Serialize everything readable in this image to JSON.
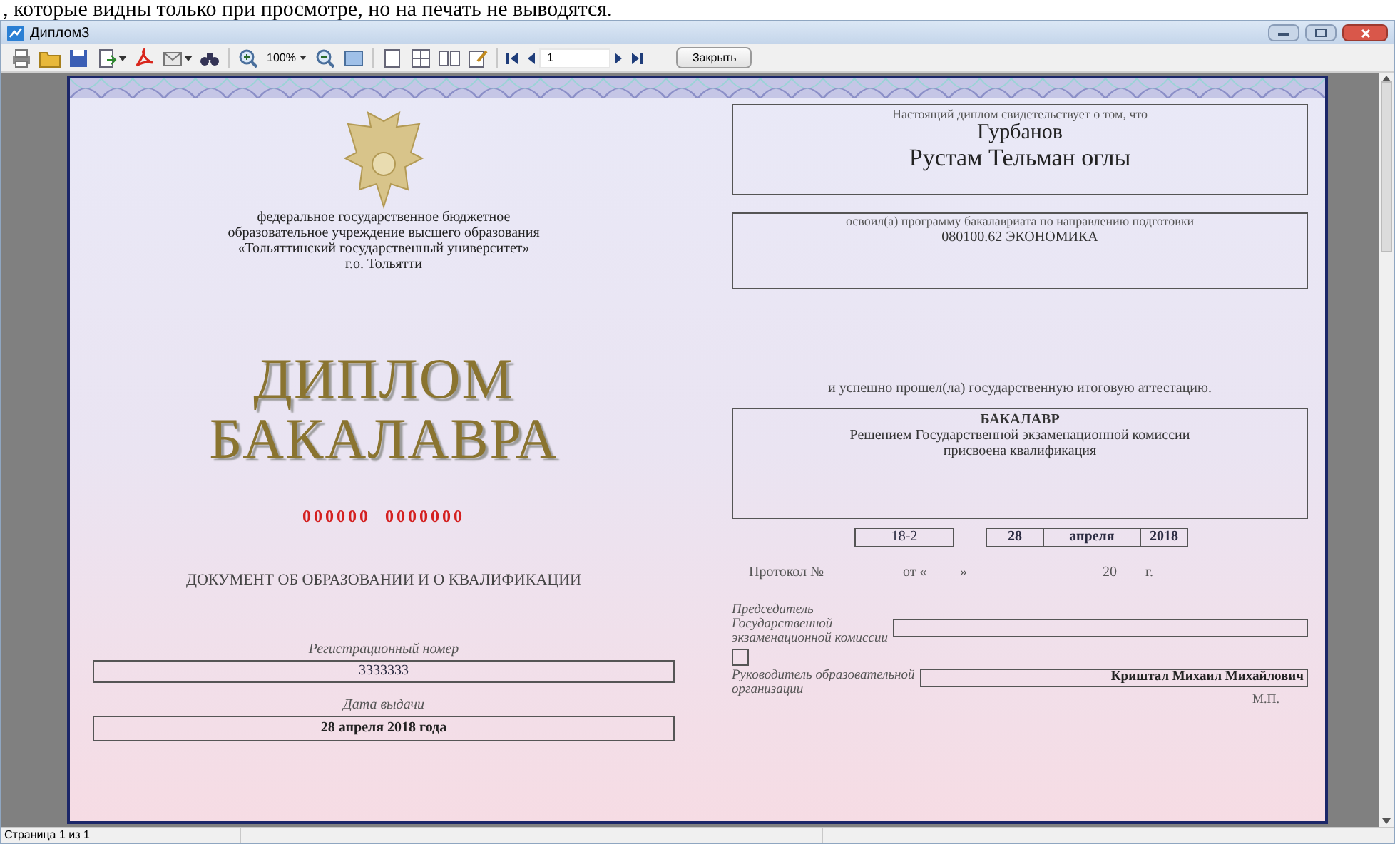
{
  "header_text": ", которые видны только при просмотре, но на печать не выводятся.",
  "window": {
    "title": "Диплом3"
  },
  "toolbar": {
    "zoom": "100%",
    "page_input": "1",
    "close_button": "Закрыть"
  },
  "document": {
    "left": {
      "organization": [
        "федеральное государственное бюджетное",
        "образовательное учреждение высшего образования",
        "«Тольяттинский государственный университет»",
        "г.о. Тольятти"
      ],
      "title": [
        "ДИПЛОМ",
        "БАКАЛАВРА"
      ],
      "serial": "000000  0000000",
      "doc_type": "ДОКУМЕНТ ОБ ОБРАЗОВАНИИ И О КВАЛИФИКАЦИИ",
      "reg_label": "Регистрационный номер",
      "reg_number": "3333333",
      "date_label": "Дата выдачи",
      "date_value": "28 апреля 2018 года"
    },
    "right": {
      "intro": "Настоящий диплом свидетельствует о том, что",
      "surname": "Гурбанов",
      "name": "Рустам Тельман оглы",
      "program_label": "освоил(а) программу бакалавриата по направлению подготовки",
      "program": "080100.62 ЭКОНОМИКА",
      "passed_text": "и успешно прошел(ла) государственную итоговую аттестацию.",
      "qualification": [
        "БАКАЛАВР",
        "Решением Государственной экзаменационной комиссии",
        "присвоена квалификация"
      ],
      "protocol_values": {
        "number": "18-2",
        "day": "28",
        "month": "апреля",
        "year": "2018"
      },
      "protocol_labels": {
        "number": "Протокол №",
        "from": "от «",
        "close_quote": "»",
        "century": "20",
        "year_suffix": "г."
      },
      "chair_label": [
        "Председатель",
        "Государственной",
        "экзаменационной комиссии"
      ],
      "head_label": [
        "Руководитель образовательной",
        "организации"
      ],
      "head_name": "Криштал Михаил Михайлович",
      "stamp": "М.П."
    }
  },
  "status_bar": "Страница 1 из 1"
}
